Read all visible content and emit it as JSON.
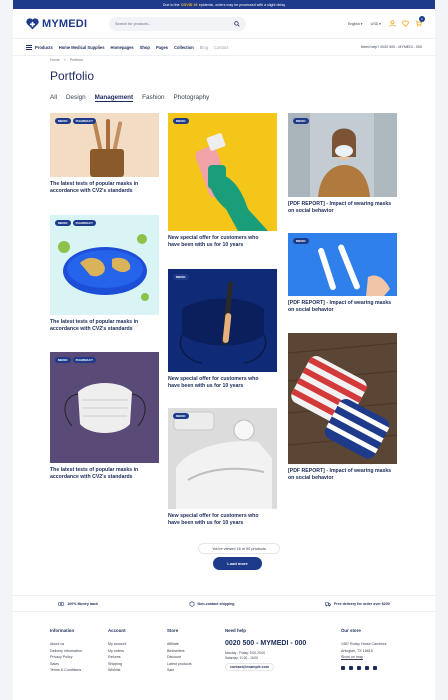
{
  "topbar": {
    "pre": "Due to the",
    "highlight": "COVID 19",
    "post": "epidemic, orders may be processed with a slight delay"
  },
  "header": {
    "logo": "MYMEDI",
    "search_placeholder": "Search for products...",
    "language": "English",
    "currency": "USD",
    "cart_count": "0"
  },
  "nav": {
    "products": "Products",
    "items": [
      "Home Medical Supplies",
      "Homepages",
      "Shop",
      "Pages",
      "Collection"
    ],
    "muted_items": [
      "Blog",
      "Contact"
    ],
    "help": "Need help? 0020 500 - MYMEDI - 000"
  },
  "breadcrumb": {
    "home": "Home",
    "sep": ">",
    "current": "Portfolio"
  },
  "page_title": "Portfolio",
  "filters": [
    "All",
    "Design",
    "Management",
    "Fashion",
    "Photography"
  ],
  "active_filter": "Management",
  "cards": [
    {
      "caption": "The latest tests of popular masks in accordance with CV2's standards",
      "tags": [
        "MEDIC",
        "PHARMACY"
      ]
    },
    {
      "caption": "The latest tests of popular masks in accordance with CV2's standards",
      "tags": [
        "MEDIC",
        "PHARMACY"
      ]
    },
    {
      "caption": "The latest tests of popular masks in accordance with CV2's standards",
      "tags": [
        "MEDIC",
        "PHARMACY"
      ]
    },
    {
      "caption": "New special offer for customers who have been with us for 10 years",
      "tags": [
        "MEDIC"
      ]
    },
    {
      "caption": "New special offer for customers who have been with us for 10 years",
      "tags": [
        "MEDIC"
      ]
    },
    {
      "caption": "New special offer for customers who have been with us for 10 years",
      "tags": [
        "MEDIC"
      ]
    },
    {
      "caption": "[PDF REPORT] - Impact of wearing masks on social behavior",
      "tags": [
        "MEDIC"
      ]
    },
    {
      "caption": "[PDF REPORT] - Impact of wearing masks on social behavior",
      "tags": [
        "MEDIC"
      ]
    },
    {
      "caption": "[PDF REPORT] - Impact of wearing masks on social behavior",
      "tags": [
        "MEDIC"
      ]
    }
  ],
  "pagination": {
    "viewed": "You're viewed 16 of 50 products",
    "load_more": "Load more"
  },
  "benefits": [
    "100% Money back",
    "Non-contact shipping",
    "Free delivery for order over $200"
  ],
  "footer": {
    "information": {
      "title": "Information",
      "links": [
        "About us",
        "Delivery information",
        "Privacy Policy",
        "Sales",
        "Terms & Conditions"
      ]
    },
    "account": {
      "title": "Account",
      "links": [
        "My account",
        "My orders",
        "Returns",
        "Shipping",
        "Wishlist"
      ]
    },
    "store": {
      "title": "Store",
      "links": [
        "Affiliate",
        "Bestsellers",
        "Discount",
        "Latest products",
        "Sale"
      ]
    },
    "help": {
      "title": "Need help",
      "phone": "0020 500 - MYMEDI - 000",
      "hours1": "Monday - Friday: 9:00-20:00",
      "hours2": "Saturday: 11:00 - 15:00",
      "email": "contact@example.com"
    },
    "store_info": {
      "title": "Our store",
      "address1": "1487 Rocky Horse Carrefour",
      "address2": "Arlington, TX 16819",
      "map": "Show on map"
    }
  },
  "colors": {
    "primary": "#1e3a8a",
    "accent": "#fbbf24",
    "text": "#1c2b5a"
  }
}
